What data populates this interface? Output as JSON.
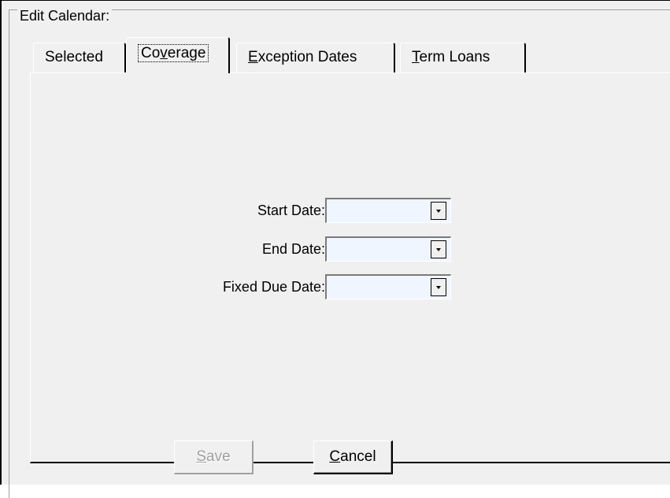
{
  "group": {
    "title": "Edit Calendar:"
  },
  "tabs": [
    {
      "label": "Selected",
      "mnemonic": "",
      "rest": "Selected",
      "active": false
    },
    {
      "label": "Coverage",
      "mnemonic": "v",
      "pre": "Co",
      "rest": "erage",
      "active": true
    },
    {
      "label": "Exception Dates",
      "mnemonic": "E",
      "pre": "",
      "rest": "xception Dates",
      "active": false
    },
    {
      "label": "Term Loans",
      "mnemonic": "T",
      "pre": "",
      "rest": "erm Loans",
      "active": false
    }
  ],
  "fields": {
    "start_date": {
      "label": "Start Date:",
      "value": ""
    },
    "end_date": {
      "label": "End Date:",
      "value": ""
    },
    "fixed_due_date": {
      "label": "Fixed Due Date:",
      "value": ""
    }
  },
  "buttons": {
    "save": {
      "mnemonic": "S",
      "rest": "ave",
      "enabled": false
    },
    "cancel": {
      "mnemonic": "C",
      "rest": "ancel",
      "enabled": true
    }
  },
  "icons": {
    "dropdown": "dropdown-arrow-icon"
  },
  "colors": {
    "panel": "#f0f0f0",
    "combo_bg": "#f0f6ff",
    "disabled_text": "#a0a0a0"
  }
}
